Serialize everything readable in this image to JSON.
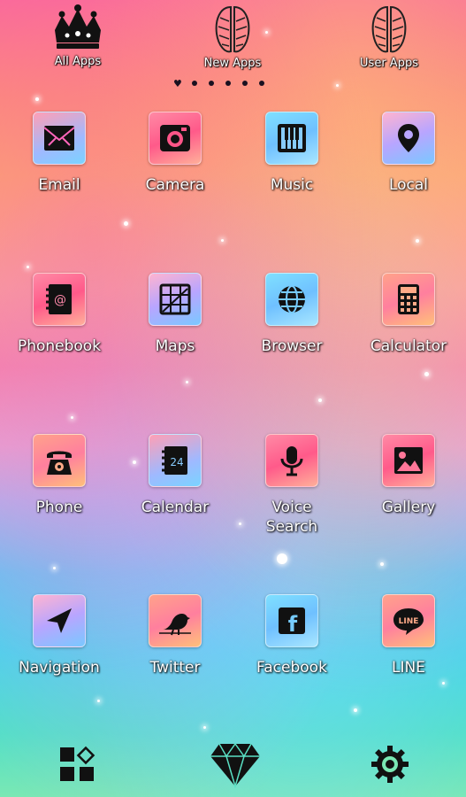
{
  "top_shelf": [
    {
      "label": "All Apps",
      "icon": "crown-icon"
    },
    {
      "label": "New Apps",
      "icon": "angel-wings-icon"
    },
    {
      "label": "User Apps",
      "icon": "angel-wings-icon"
    }
  ],
  "page_indicator": {
    "current_page": 1,
    "page_count": 6,
    "current_marker": "heart-icon"
  },
  "apps": [
    {
      "label": "Email",
      "icon": "envelope-icon"
    },
    {
      "label": "Camera",
      "icon": "camera-icon"
    },
    {
      "label": "Music",
      "icon": "piano-keys-icon"
    },
    {
      "label": "Local",
      "icon": "map-pin-icon"
    },
    {
      "label": "Phonebook",
      "icon": "address-book-icon"
    },
    {
      "label": "Maps",
      "icon": "map-grid-icon"
    },
    {
      "label": "Browser",
      "icon": "globe-icon"
    },
    {
      "label": "Calculator",
      "icon": "calculator-icon"
    },
    {
      "label": "Phone",
      "icon": "telephone-icon"
    },
    {
      "label": "Calendar",
      "icon": "calendar-icon",
      "badge": "24"
    },
    {
      "label": "Voice Search",
      "line1": "Voice",
      "line2": "Search",
      "icon": "microphone-icon"
    },
    {
      "label": "Gallery",
      "icon": "picture-icon"
    },
    {
      "label": "Navigation",
      "icon": "navigation-arrow-icon"
    },
    {
      "label": "Twitter",
      "icon": "bird-icon"
    },
    {
      "label": "Facebook",
      "icon": "facebook-icon",
      "glyph": "f"
    },
    {
      "label": "LINE",
      "icon": "line-bubble-icon",
      "glyph": "LINE"
    }
  ],
  "dock": [
    {
      "name": "app-drawer",
      "icon": "widgets-grid-icon"
    },
    {
      "name": "theme",
      "icon": "diamond-icon"
    },
    {
      "name": "settings",
      "icon": "gear-icon"
    }
  ]
}
